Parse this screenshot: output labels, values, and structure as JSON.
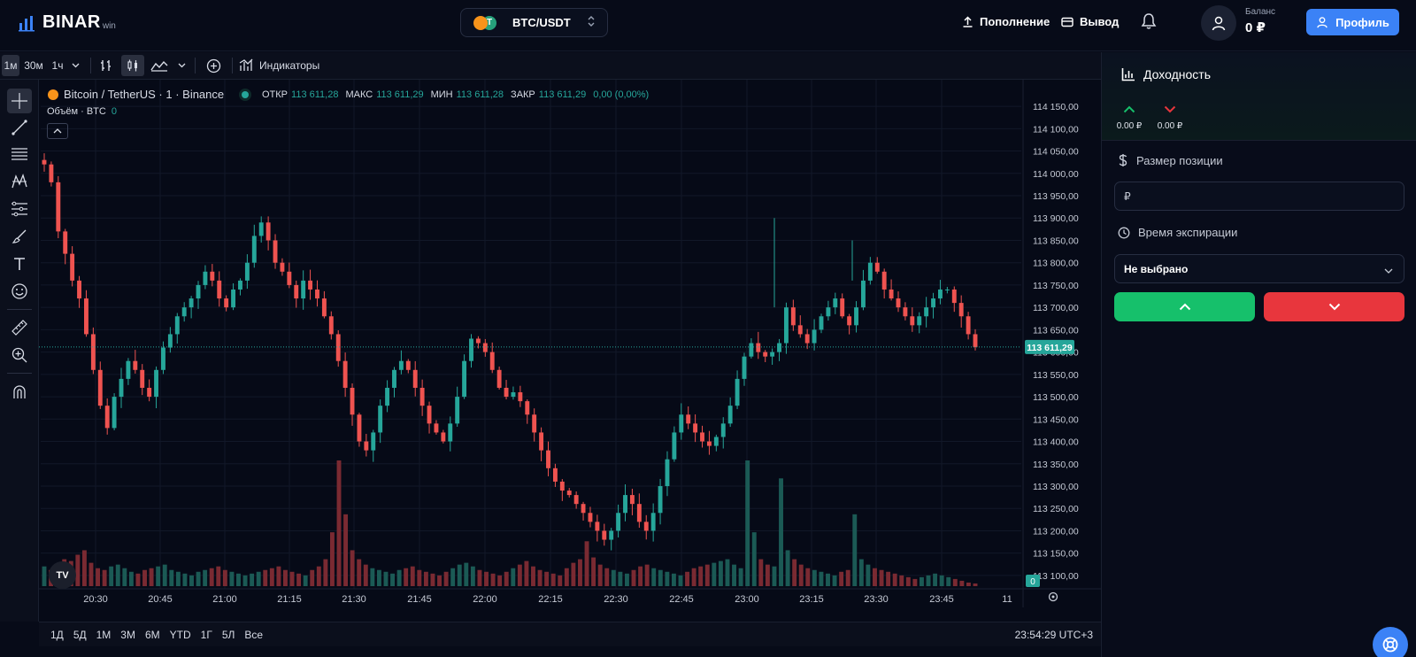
{
  "header": {
    "logo_text": "BINAR",
    "logo_sub": "win",
    "pair": "BTC/USDT",
    "pair_coin_badge": "T",
    "deposit_label": "Пополнение",
    "withdraw_label": "Вывод",
    "balance_label": "Баланс",
    "balance_value": "0 ₽",
    "profile_label": "Профиль"
  },
  "toolbar": {
    "intervals": [
      "1м",
      "30м",
      "1ч"
    ],
    "active_interval": "1м",
    "indicators_label": "Индикаторы"
  },
  "legend": {
    "symbol": "Bitcoin / TetherUS · 1 · Binance",
    "open_label": "ОТКР",
    "open": "113 611,28",
    "high_label": "МАКС",
    "high": "113 611,29",
    "low_label": "МИН",
    "low": "113 611,28",
    "close_label": "ЗАКР",
    "close": "113 611,29",
    "change": "0,00 (0,00%)",
    "volume_label": "Объём · BTC",
    "volume_value": "0"
  },
  "chart_data": {
    "type": "candlestick",
    "y_tick_labels": [
      "114 150,00",
      "114 100,00",
      "114 050,00",
      "114 000,00",
      "113 950,00",
      "113 900,00",
      "113 850,00",
      "113 800,00",
      "113 750,00",
      "113 700,00",
      "113 650,00",
      "113 600,00",
      "113 550,00",
      "113 500,00",
      "113 450,00",
      "113 400,00",
      "113 350,00",
      "113 300,00",
      "113 250,00",
      "113 200,00",
      "113 150,00",
      "113 100,00"
    ],
    "y_ticks": [
      114150,
      114100,
      114050,
      114000,
      113950,
      113900,
      113850,
      113800,
      113750,
      113700,
      113650,
      113600,
      113550,
      113500,
      113450,
      113400,
      113350,
      113300,
      113250,
      113200,
      113150,
      113100
    ],
    "x_tick_labels": [
      "20:30",
      "20:45",
      "21:00",
      "21:15",
      "21:30",
      "21:45",
      "22:00",
      "22:15",
      "22:30",
      "22:45",
      "23:00",
      "23:15",
      "23:30",
      "23:45"
    ],
    "x_extra_label": "11",
    "current_price": 113611.29,
    "current_price_label": "113 611,29",
    "volume_last_label": "0",
    "ylim": [
      113080,
      114170
    ],
    "close_path": [
      114020,
      113980,
      113870,
      113820,
      113760,
      113720,
      113640,
      113560,
      113480,
      113430,
      113500,
      113540,
      113580,
      113560,
      113520,
      113500,
      113560,
      113610,
      113640,
      113680,
      113700,
      113720,
      113750,
      113780,
      113760,
      113720,
      113700,
      113740,
      113760,
      113800,
      113860,
      113890,
      113850,
      113800,
      113780,
      113750,
      113720,
      113760,
      113740,
      113720,
      113680,
      113640,
      113580,
      113520,
      113460,
      113400,
      113380,
      113420,
      113480,
      113520,
      113560,
      113580,
      113560,
      113520,
      113480,
      113440,
      113420,
      113400,
      113440,
      113500,
      113580,
      113630,
      113620,
      113600,
      113560,
      113520,
      113500,
      113510,
      113490,
      113460,
      113420,
      113380,
      113340,
      113310,
      113290,
      113280,
      113260,
      113240,
      113220,
      113200,
      113180,
      113200,
      113240,
      113280,
      113260,
      113220,
      113200,
      113240,
      113300,
      113360,
      113420,
      113460,
      113440,
      113420,
      113400,
      113390,
      113410,
      113440,
      113480,
      113540,
      113590,
      113620,
      113600,
      113590,
      113600,
      113620,
      113700,
      113660,
      113640,
      113620,
      113650,
      113680,
      113700,
      113720,
      113680,
      113660,
      113700,
      113760,
      113800,
      113780,
      113740,
      113720,
      113700,
      113680,
      113660,
      113680,
      113700,
      113720,
      113740,
      113740,
      113710,
      113680,
      113640,
      113611
    ],
    "volume_bars": [
      22,
      18,
      25,
      30,
      28,
      35,
      40,
      26,
      20,
      18,
      22,
      24,
      20,
      16,
      14,
      18,
      20,
      22,
      24,
      18,
      16,
      14,
      12,
      16,
      18,
      20,
      22,
      18,
      16,
      14,
      12,
      14,
      16,
      18,
      20,
      22,
      18,
      16,
      14,
      12,
      18,
      22,
      30,
      60,
      140,
      80,
      40,
      30,
      24,
      20,
      18,
      16,
      14,
      18,
      20,
      22,
      18,
      16,
      14,
      12,
      16,
      20,
      24,
      26,
      22,
      18,
      16,
      14,
      12,
      16,
      20,
      24,
      28,
      22,
      18,
      16,
      14,
      12,
      20,
      26,
      30,
      50,
      32,
      24,
      20,
      18,
      16,
      14,
      18,
      22,
      24,
      20,
      18,
      16,
      14,
      12,
      16,
      20,
      22,
      24,
      26,
      28,
      30,
      24,
      20,
      140,
      60,
      30,
      24,
      22,
      120,
      40,
      30,
      24,
      20,
      18,
      16,
      14,
      12,
      16,
      18,
      80,
      30,
      24,
      20,
      18,
      16,
      14,
      12,
      10,
      8,
      10,
      12,
      14,
      12,
      10,
      8,
      6,
      4,
      3
    ]
  },
  "range_buttons": [
    "1Д",
    "5Д",
    "1М",
    "3М",
    "6М",
    "YTD",
    "1Г",
    "5Л",
    "Все"
  ],
  "clock": "23:54:29 UTC+3",
  "panel": {
    "yield_title": "Доходность",
    "up_value": "0.00 ₽",
    "down_value": "0.00 ₽",
    "size_label": "Размер позиции",
    "size_placeholder": "₽",
    "expiry_label": "Время экспирации",
    "expiry_value": "Не выбрано"
  },
  "colors": {
    "up": "#26a69a",
    "down": "#ef5350",
    "buy_button": "#16c06b",
    "sell_button": "#e8363d",
    "accent": "#3b82f6"
  }
}
